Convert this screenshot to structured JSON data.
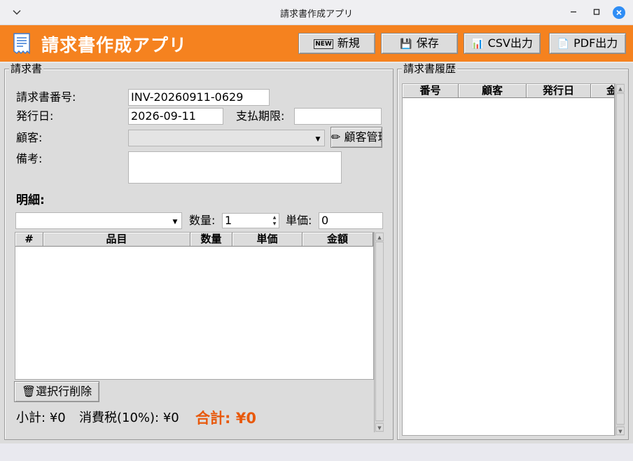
{
  "window": {
    "title": "請求書作成アプリ",
    "menu_icon": "chevron-down-icon",
    "controls": {
      "minimize": "–",
      "maximize": "□",
      "close": "✕"
    }
  },
  "header": {
    "title": "請求書作成アプリ",
    "logo_icon": "receipt-icon",
    "buttons": {
      "new": {
        "icon_text": "NEW",
        "label": "新規"
      },
      "save": {
        "icon_text": "💾",
        "label": "保存"
      },
      "csv": {
        "icon_text": "📊",
        "label": "CSV出力"
      },
      "pdf": {
        "icon_text": "📄",
        "label": "PDF出力"
      }
    },
    "accent_color": "#f5821f"
  },
  "invoice": {
    "group_title": "請求書",
    "number_label": "請求書番号:",
    "number_value": "INV-20260911-0629",
    "issue_date_label": "発行日:",
    "issue_date_value": "2026-09-11",
    "due_date_label": "支払期限:",
    "due_date_value": "",
    "customer_label": "顧客:",
    "customer_value": "",
    "customer_button": {
      "icon_text": "✏",
      "label": "顧客管理"
    },
    "notes_label": "備考:",
    "notes_value": ""
  },
  "details": {
    "heading": "明細:",
    "product_value": "",
    "quantity_label": "数量:",
    "quantity_value": "1",
    "unit_price_label": "単価:",
    "unit_price_value": "0",
    "columns": [
      "#",
      "品目",
      "数量",
      "単価",
      "金額"
    ],
    "rows": [],
    "delete_button": {
      "icon_text": "🗑",
      "label": "選択行削除"
    }
  },
  "totals": {
    "subtotal_label": "小計:",
    "subtotal_value": "¥0",
    "tax_label": "消費税(10%):",
    "tax_value": "¥0",
    "grand_label": "合計:",
    "grand_value": "¥0",
    "grand_color": "#e8590c"
  },
  "history": {
    "group_title": "請求書履歴",
    "columns": [
      "番号",
      "顧客",
      "発行日",
      "金額"
    ],
    "rows": []
  }
}
